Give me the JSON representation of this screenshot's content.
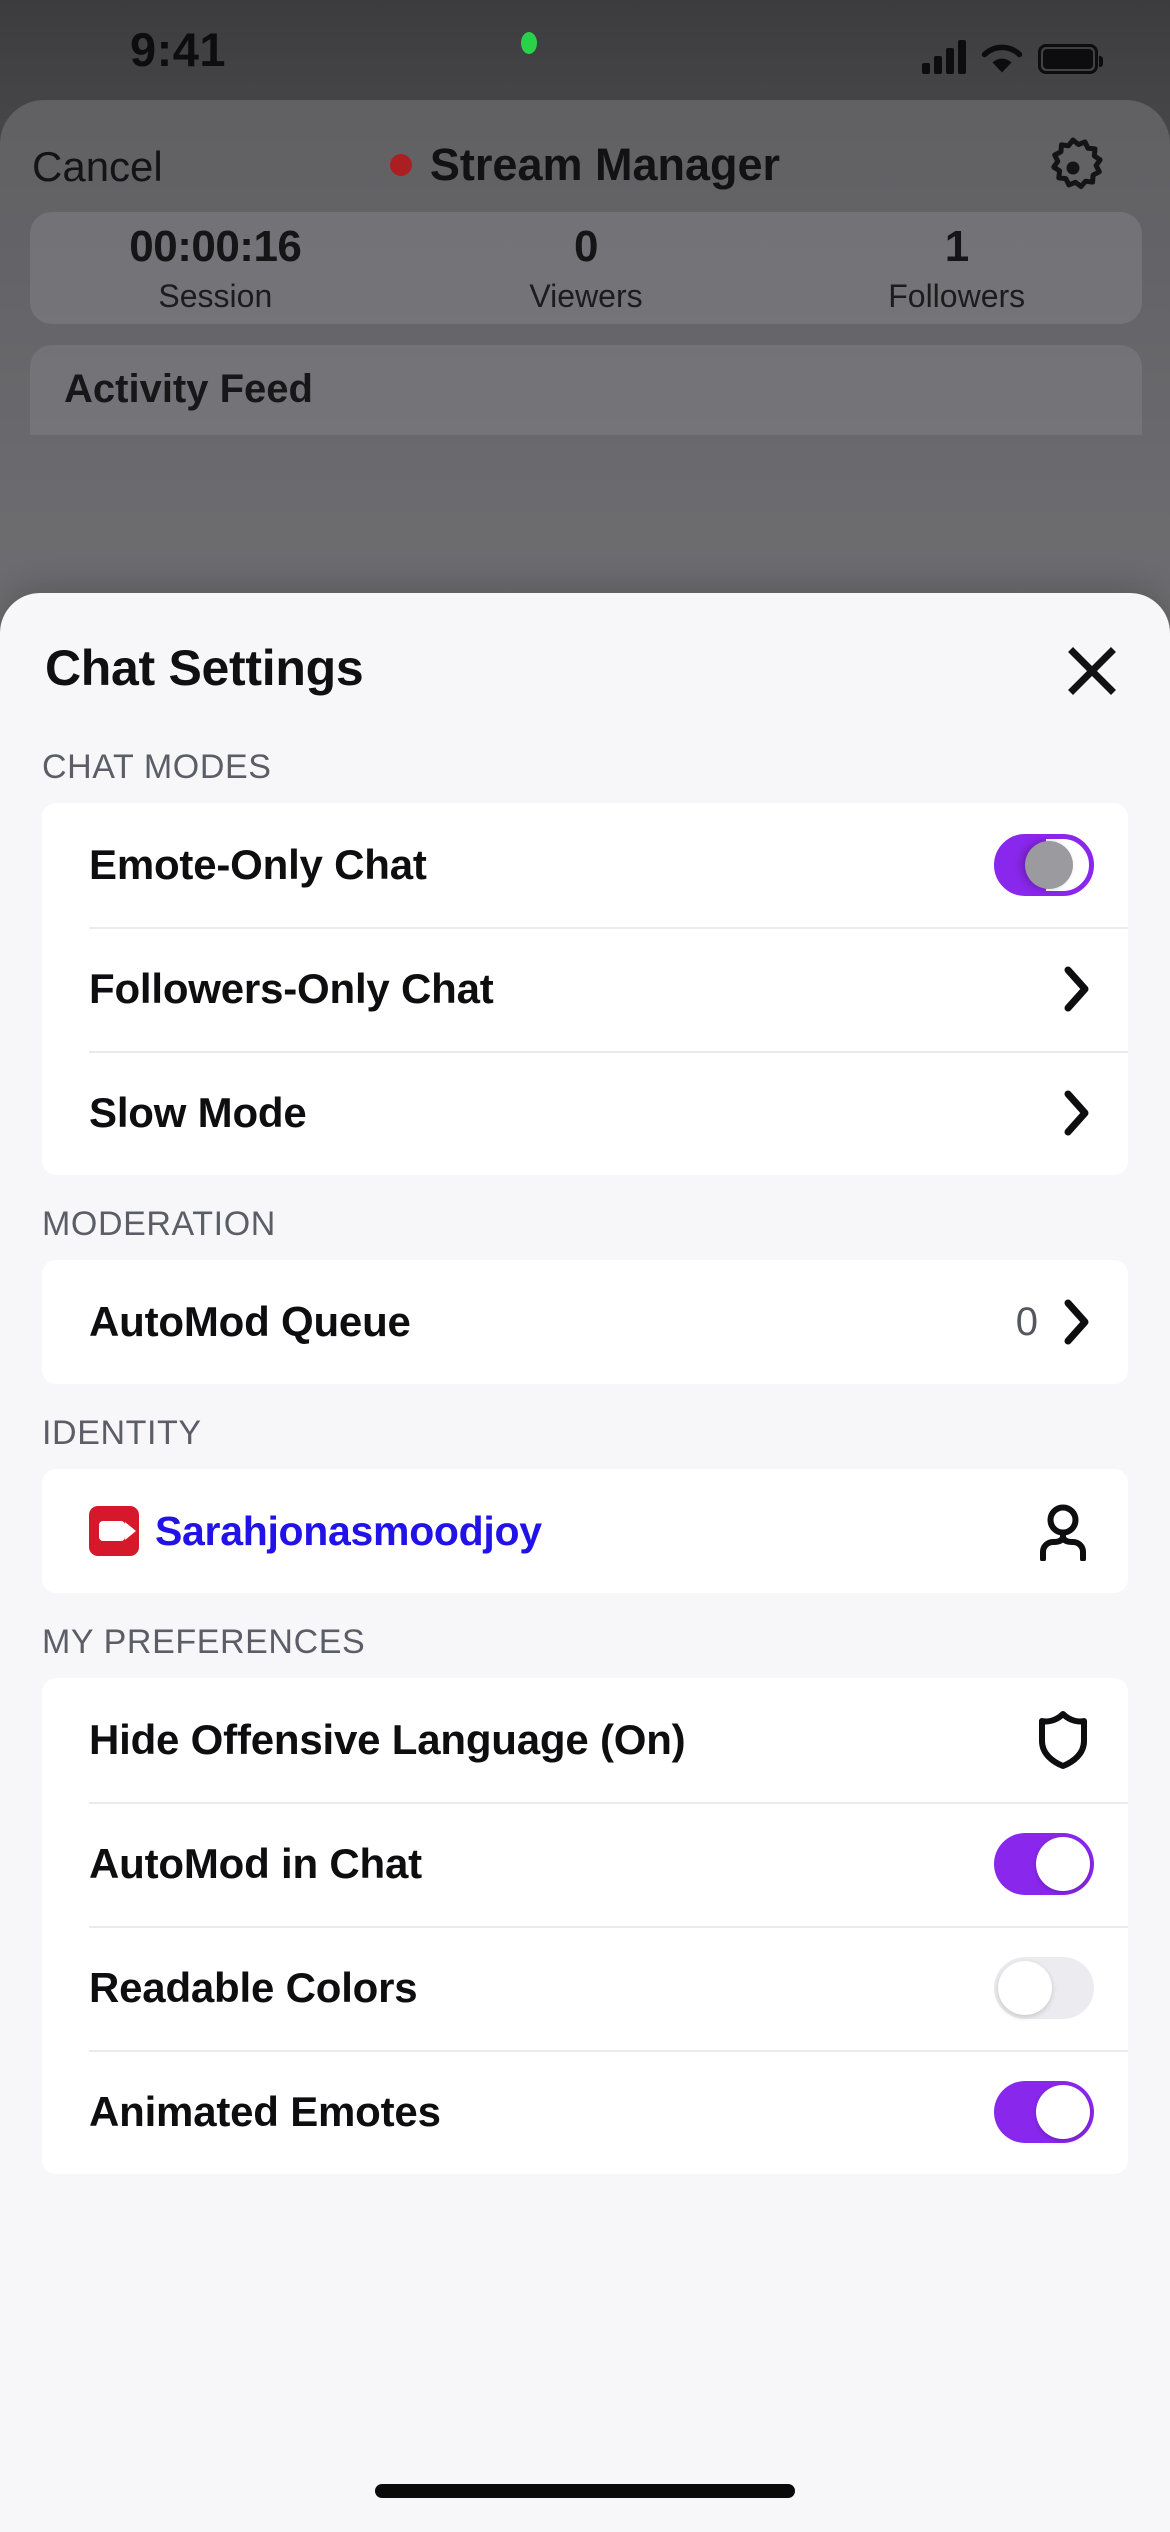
{
  "status_bar": {
    "time": "9:41",
    "recording_dot": "green-recording-indicator",
    "signal": "cellular-signal-icon",
    "wifi": "wifi-icon",
    "battery": "battery-icon"
  },
  "background_app": {
    "nav": {
      "cancel_label": "Cancel",
      "title": "Stream Manager",
      "live_indicator": "live-dot",
      "settings_icon": "gear-icon"
    },
    "stats": [
      {
        "value": "00:00:16",
        "label": "Session"
      },
      {
        "value": "0",
        "label": "Viewers"
      },
      {
        "value": "1",
        "label": "Followers"
      }
    ],
    "activity_feed_title": "Activity Feed"
  },
  "sheet": {
    "title": "Chat Settings",
    "close_icon": "close-icon",
    "sections": [
      {
        "header": "CHAT MODES",
        "rows": [
          {
            "label": "Emote-Only Chat",
            "control": "toggle",
            "state": "transitioning"
          },
          {
            "label": "Followers-Only Chat",
            "control": "chevron"
          },
          {
            "label": "Slow Mode",
            "control": "chevron"
          }
        ]
      },
      {
        "header": "MODERATION",
        "rows": [
          {
            "label": "AutoMod Queue",
            "value": "0",
            "control": "chevron"
          }
        ]
      },
      {
        "header": "IDENTITY",
        "rows": [
          {
            "label": "Sarahjonasmoodjoy",
            "badge": "video-badge-icon",
            "control": "person-icon"
          }
        ]
      },
      {
        "header": "MY PREFERENCES",
        "rows": [
          {
            "label": "Hide Offensive Language (On)",
            "control": "shield-icon"
          },
          {
            "label": "AutoMod in Chat",
            "control": "toggle",
            "state": "on"
          },
          {
            "label": "Readable Colors",
            "control": "toggle",
            "state": "off"
          },
          {
            "label": "Animated Emotes",
            "control": "toggle",
            "state": "on"
          }
        ]
      }
    ]
  },
  "colors": {
    "accent_purple": "#8A27EC",
    "username_blue": "#2112E8",
    "badge_red": "#D6192A",
    "live_red": "#AB1F22",
    "sheet_bg": "#F7F7FA",
    "card_bg": "#FFFFFF",
    "section_header": "#5D5D68"
  }
}
